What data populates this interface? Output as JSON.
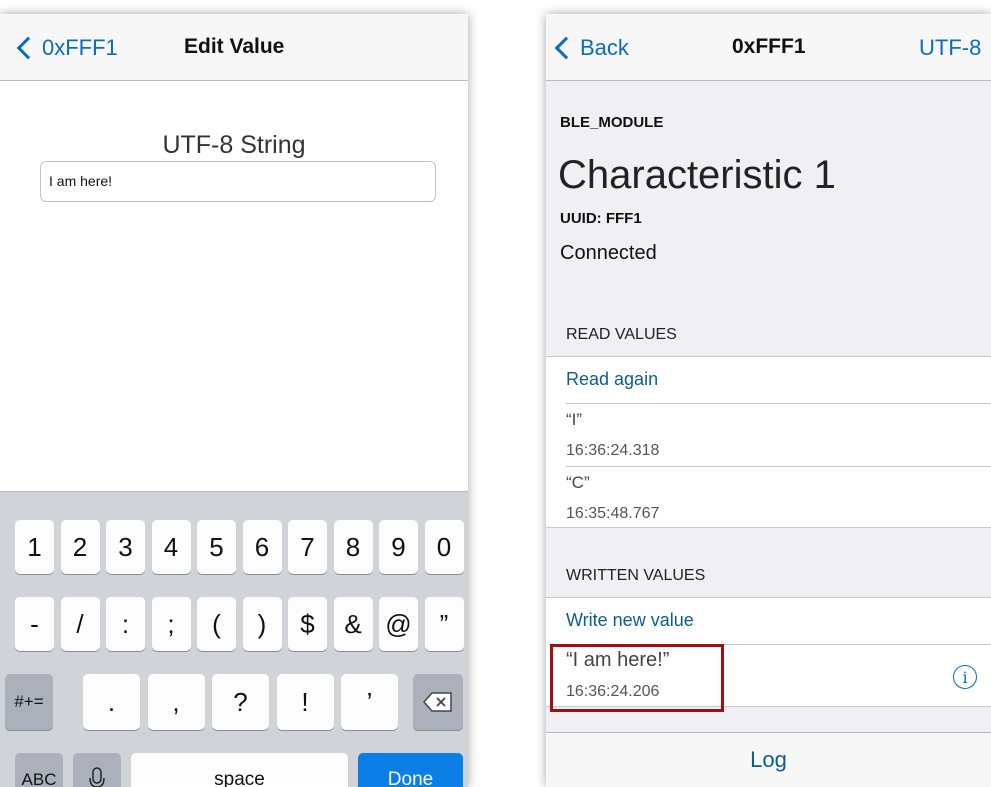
{
  "left_screen": {
    "nav": {
      "back_label": "0xFFF1",
      "title": "Edit Value"
    },
    "heading": "UTF-8 String",
    "input_value": "I am here!",
    "keyboard": {
      "row1": [
        "1",
        "2",
        "3",
        "4",
        "5",
        "6",
        "7",
        "8",
        "9",
        "0"
      ],
      "row2": [
        "-",
        "/",
        ":",
        ";",
        "(",
        ")",
        "$",
        "&",
        "@",
        "”"
      ],
      "row3": [
        ".",
        ",",
        "?",
        "!",
        "’"
      ],
      "symbols_key": "#+=",
      "abc_key": "ABC",
      "space_key": "space",
      "done_key": "Done",
      "backspace_icon": "backspace-icon",
      "mic_icon": "microphone-icon"
    }
  },
  "right_screen": {
    "nav": {
      "back_label": "Back",
      "title": "0xFFF1",
      "right_label": "UTF-8"
    },
    "device_name": "BLE_MODULE",
    "characteristic_title": "Characteristic 1",
    "uuid": "UUID: FFF1",
    "status": "Connected",
    "read_values": {
      "header": "READ VALUES",
      "action": "Read again",
      "items": [
        {
          "value": "“I”",
          "time": "16:36:24.318"
        },
        {
          "value": "“C”",
          "time": "16:35:48.767"
        }
      ]
    },
    "written_values": {
      "header": "WRITTEN VALUES",
      "action": "Write new value",
      "items": [
        {
          "value": "“I am here!”",
          "time": "16:36:24.206"
        }
      ]
    },
    "tab_label": "Log",
    "highlight_color": "#a01010",
    "accent_color": "#0a6dbf"
  }
}
